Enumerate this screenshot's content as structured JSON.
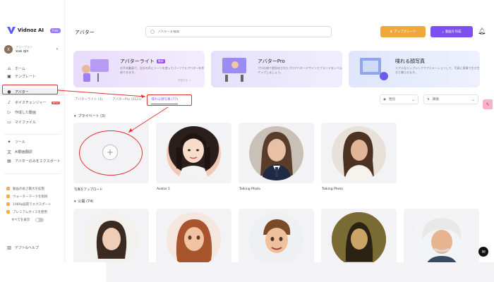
{
  "app": {
    "name": "Vidnoz AI",
    "badge": "Free"
  },
  "user": {
    "initial": "X",
    "plan": "フリープラン",
    "name": "xue qin"
  },
  "sidebar": {
    "items": [
      {
        "label": "ホーム",
        "icon": "home-icon"
      },
      {
        "label": "テンプレート",
        "icon": "template-icon"
      },
      {
        "label": "アバター",
        "icon": "avatar-icon"
      },
      {
        "label": "ボイスチェンジャー",
        "icon": "voice-icon",
        "badge": "NEW"
      },
      {
        "label": "作成した動画",
        "icon": "video-icon"
      },
      {
        "label": "マイファイル",
        "icon": "folder-icon"
      }
    ],
    "tools": [
      {
        "label": "ツール",
        "icon": "tools-icon"
      },
      {
        "label": "AI動画翻訳",
        "icon": "translate-icon"
      },
      {
        "label": "アバターのみをエクスポート",
        "icon": "export-icon"
      }
    ],
    "features": [
      "動画の長さ最大を拡張",
      "ウォーターマークを削除",
      "1080p画質でエクスポート",
      "プレミアムボイスを使用"
    ],
    "show_all": "すべてを表示",
    "trial": "デフト&ヘルプ"
  },
  "header": {
    "title": "アバター",
    "search_placeholder": "アバターを検索",
    "upgrade_label": "アップグレード",
    "create_label": "動画を作成"
  },
  "promos": [
    {
      "title": "アバターライト",
      "badge": "無料",
      "desc": "お手本動画で、自分の声とトーンを使ってパーソナルアバターを作成できます。",
      "cta": "作成する →"
    },
    {
      "title": "アバターPro",
      "desc": "プロ仕様で差別化されたプロアバターデザインでブランドをレベルアップしましょう。"
    },
    {
      "title": "喋れる顔写真",
      "desc": "リアルなリップシンクでアニメーションして、写真に表情で生き生きと喋らせます。"
    }
  ],
  "tabs": [
    {
      "label": "アバターライト (3)"
    },
    {
      "label": "アバターPro (2121)"
    },
    {
      "label": "喋れる顔写真 (77)"
    }
  ],
  "filters": {
    "filter_label": "性別",
    "sort_label": "降順"
  },
  "sections": {
    "private": "プライベート (3)",
    "public": "公開 (74)"
  },
  "private_cards": [
    {
      "label": "写真をアップロード"
    },
    {
      "label": "Avatar 1"
    },
    {
      "label": "Talking Photo"
    },
    {
      "label": "Talking Photo"
    }
  ],
  "colors": {
    "accent": "#7b4ff0",
    "upgrade": "#f1a83b",
    "highlight": "#e23232"
  }
}
